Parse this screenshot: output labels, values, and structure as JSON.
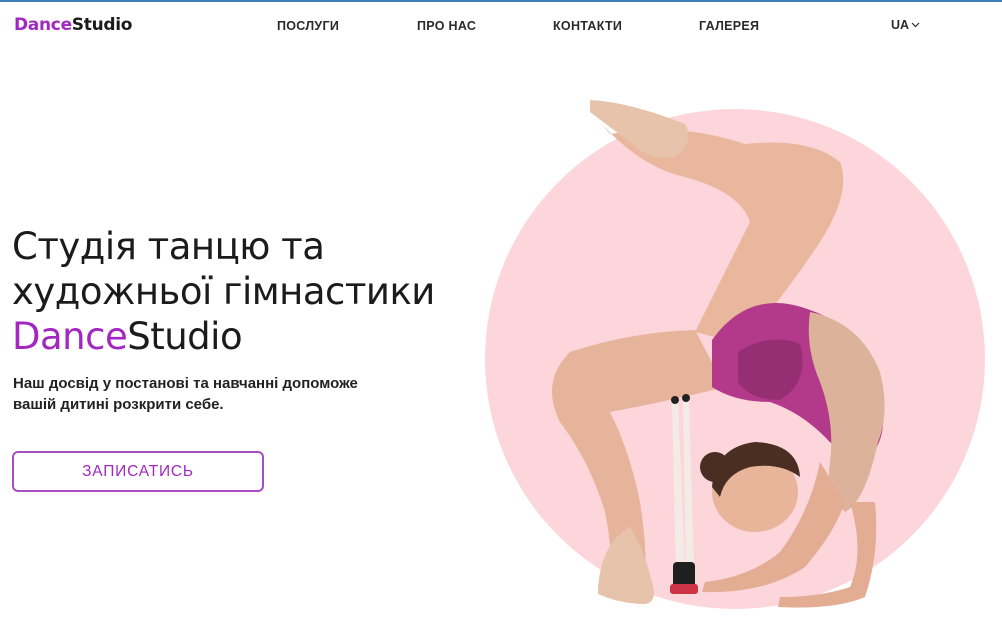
{
  "header": {
    "logo_part1": "Dance",
    "logo_part2": "Studio",
    "nav": [
      {
        "label": "ПОСЛУГИ"
      },
      {
        "label": "ПРО НАС"
      },
      {
        "label": "КОНТАКТИ"
      },
      {
        "label": "ГАЛЕРЕЯ"
      }
    ],
    "language": "UA"
  },
  "hero": {
    "title_line1": "Студія танцю та",
    "title_line2": "художньої гімнастики",
    "title_brand_part1": "Dance",
    "title_brand_part2": "Studio",
    "subtitle": "Наш досвід у постанові та навчанні допоможе вашій дитині розкрити себе.",
    "cta_label": "ЗАПИСАТИСЬ"
  },
  "colors": {
    "accent": "#a228c1",
    "circle": "#fdd6dc",
    "text": "#1b1b1b"
  },
  "icons": {
    "language_dropdown": "chevron-down-icon"
  }
}
